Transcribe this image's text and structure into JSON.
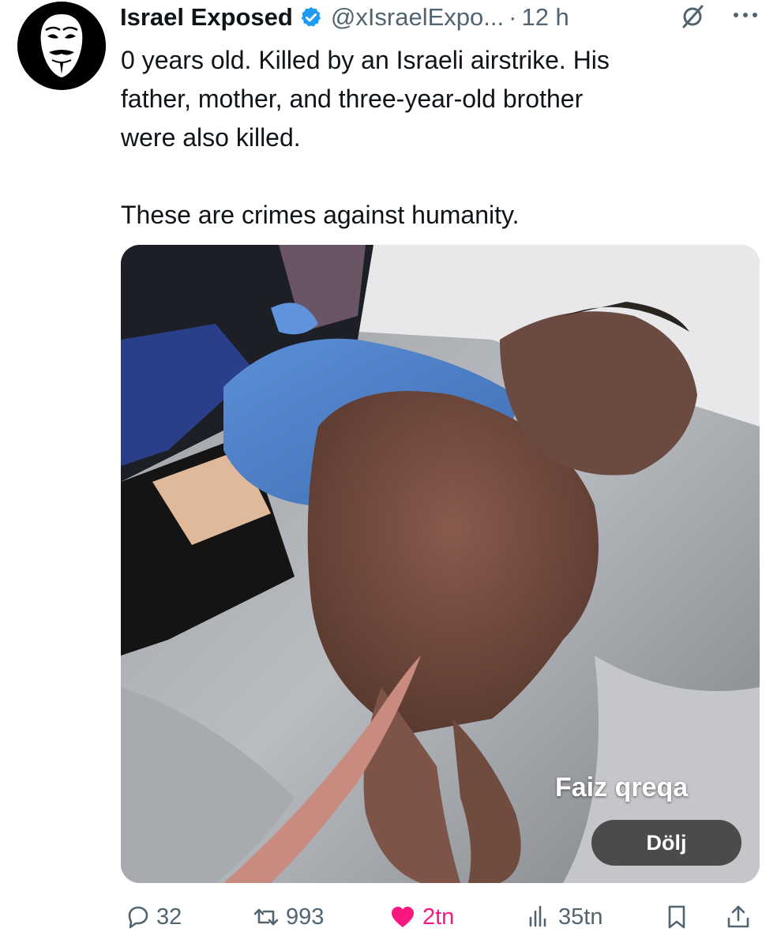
{
  "tweet": {
    "author_name": "Israel Exposed",
    "handle": "@xIsraelExpo...",
    "separator": "·",
    "time": "12 h",
    "text_lines": "0 years old. Killed by an Israeli airstrike. His\nfather, mother, and three-year-old brother\nwere also killed.",
    "text_second": "These are crimes against humanity.",
    "icons": {
      "avatar": "guy-fawkes-mask-avatar",
      "verified": "verified-badge-icon",
      "grok": "grok-icon",
      "more": "more-icon"
    }
  },
  "media": {
    "credit": "Faiz qreqa",
    "hide_label": "Dölj"
  },
  "actions": {
    "reply_count": "32",
    "retweet_count": "993",
    "like_count": "2tn",
    "views_count": "35tn"
  },
  "colors": {
    "text": "#0f1419",
    "muted": "#536471",
    "verified": "#1d9bf0",
    "like": "#f91880"
  }
}
